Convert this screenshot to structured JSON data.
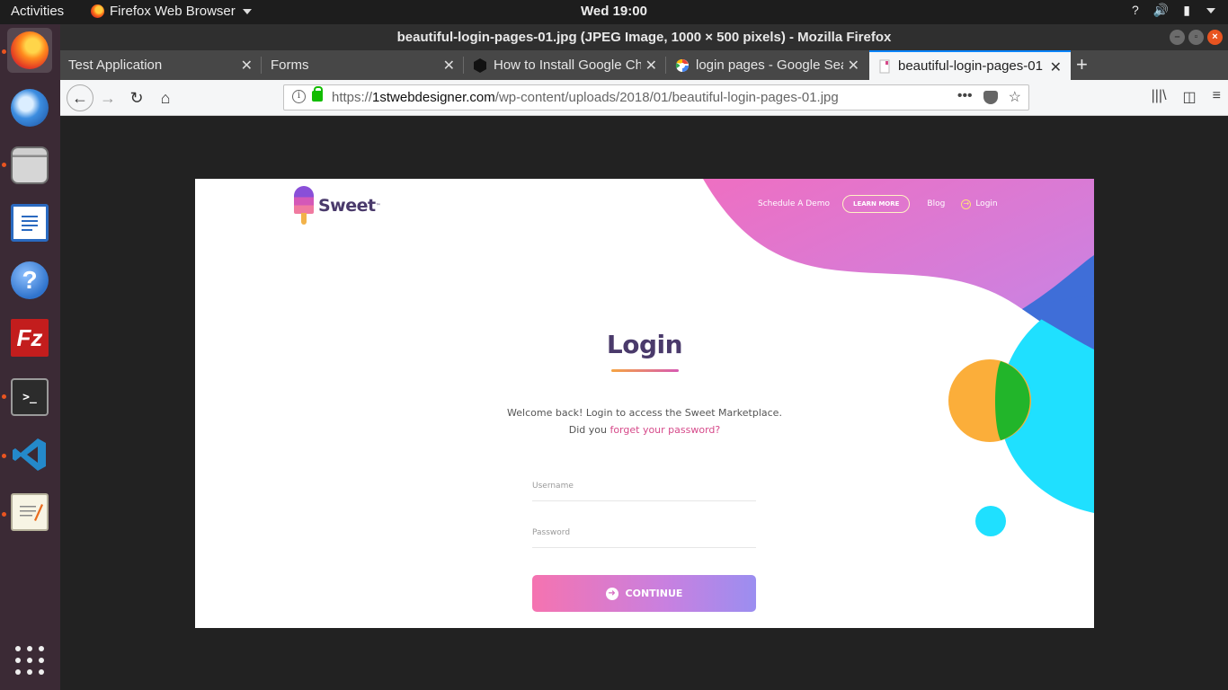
{
  "topbar": {
    "activities": "Activities",
    "app_name": "Firefox Web Browser",
    "clock": "Wed 19:00",
    "tray_icons": [
      "help-icon",
      "volume-icon",
      "battery-icon"
    ]
  },
  "dock": {
    "items": [
      "firefox",
      "thunderbird",
      "files",
      "libreoffice-writer",
      "help",
      "filezilla",
      "terminal",
      "vscode",
      "text-editor"
    ],
    "show_apps": "show-applications"
  },
  "window": {
    "title": "beautiful-login-pages-01.jpg (JPEG Image, 1000 × 500 pixels) - Mozilla Firefox"
  },
  "tabs": [
    {
      "label": "Test Application"
    },
    {
      "label": "Forms"
    },
    {
      "label": "How to Install Google Ch"
    },
    {
      "label": "login pages - Google Sea"
    },
    {
      "label": "beautiful-login-pages-01"
    }
  ],
  "navbar": {
    "url_prefix": "https://",
    "url_host": "1stwebdesigner.com",
    "url_path": "/wp-content/uploads/2018/01/beautiful-login-pages-01.jpg"
  },
  "image": {
    "brand": "Sweet",
    "tm": "™",
    "nav_demo": "Schedule A Demo",
    "nav_learn": "LEARN MORE",
    "nav_blog": "Blog",
    "nav_login": "Login",
    "heading": "Login",
    "welcome": "Welcome back! Login to access the Sweet Marketplace.",
    "did_you": "Did you ",
    "forgot": "forget your password?",
    "username_placeholder": "Username",
    "password_placeholder": "Password",
    "continue": "CONTINUE"
  },
  "colors": {
    "accent_orange": "#e95420",
    "firefox_blue": "#0a84ff",
    "brand_purple": "#4a3a6b",
    "link_pink": "#d64a8a"
  }
}
